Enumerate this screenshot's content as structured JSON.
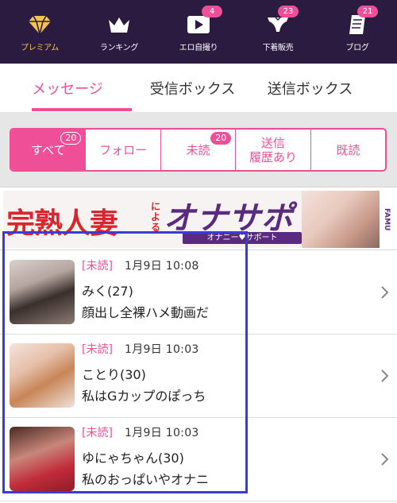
{
  "nav": {
    "items": [
      {
        "label": "プレミアム",
        "icon": "diamond-icon",
        "badge": ""
      },
      {
        "label": "ランキング",
        "icon": "crown-icon",
        "badge": ""
      },
      {
        "label": "エロ自撮り",
        "icon": "video-play-icon",
        "badge": "4"
      },
      {
        "label": "下着販売",
        "icon": "underwear-icon",
        "badge": "23"
      },
      {
        "label": "ブログ",
        "icon": "notebook-icon",
        "badge": "21"
      }
    ]
  },
  "tabs": [
    "メッセージ",
    "受信ボックス",
    "送信ボックス"
  ],
  "filters": [
    {
      "label": "すべて",
      "badge": "20"
    },
    {
      "label": "フォロー",
      "badge": ""
    },
    {
      "label": "未読",
      "badge": "20"
    },
    {
      "label": "送信\n履歴あり",
      "badge": ""
    },
    {
      "label": "既読",
      "badge": ""
    }
  ],
  "banner": {
    "title": "完熟人妻",
    "connector": "による",
    "brand_main": "オナサポ",
    "brand_sub": "オナニー♥サポート",
    "brand_logo": "FAMU"
  },
  "messages": [
    {
      "tag": "[未読]",
      "date": "1月9日 10:08",
      "name": "みく(27)",
      "text": "顔出し全裸ハメ動画だ"
    },
    {
      "tag": "[未読]",
      "date": "1月9日 10:03",
      "name": "ことり(30)",
      "text": "私はGカップのぽっち"
    },
    {
      "tag": "[未読]",
      "date": "1月9日 10:03",
      "name": "ゆにゃちゃん(30)",
      "text": "私のおっぱいやオナニ"
    }
  ],
  "colors": {
    "nav_bg": "#2b1b40",
    "accent": "#ee4f96",
    "premium_gold": "#f6c24a",
    "selection_border": "#3b3bd6"
  }
}
